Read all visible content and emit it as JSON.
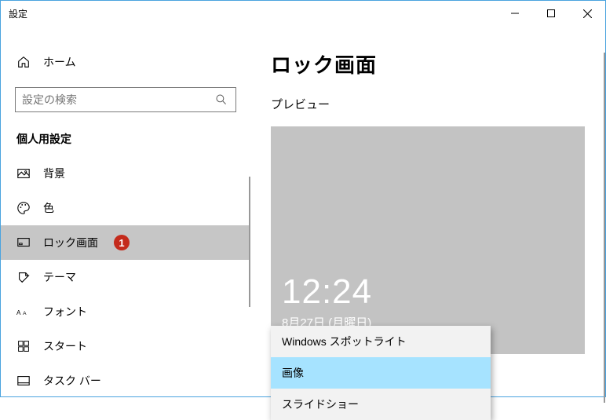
{
  "window": {
    "title": "設定"
  },
  "sidebar": {
    "home": "ホーム",
    "search_placeholder": "設定の検索",
    "section": "個人用設定",
    "items": [
      {
        "label": "背景"
      },
      {
        "label": "色"
      },
      {
        "label": "ロック画面",
        "badge": "1",
        "active": true
      },
      {
        "label": "テーマ"
      },
      {
        "label": "フォント"
      },
      {
        "label": "スタート"
      },
      {
        "label": "タスク バー"
      }
    ]
  },
  "content": {
    "title": "ロック画面",
    "preview_label": "プレビュー",
    "preview": {
      "time": "12:24",
      "date": "8月27日 (月曜日)"
    },
    "dropdown": {
      "options": [
        {
          "label": "Windows スポットライト"
        },
        {
          "label": "画像",
          "selected": true
        },
        {
          "label": "スライドショー"
        }
      ]
    }
  }
}
